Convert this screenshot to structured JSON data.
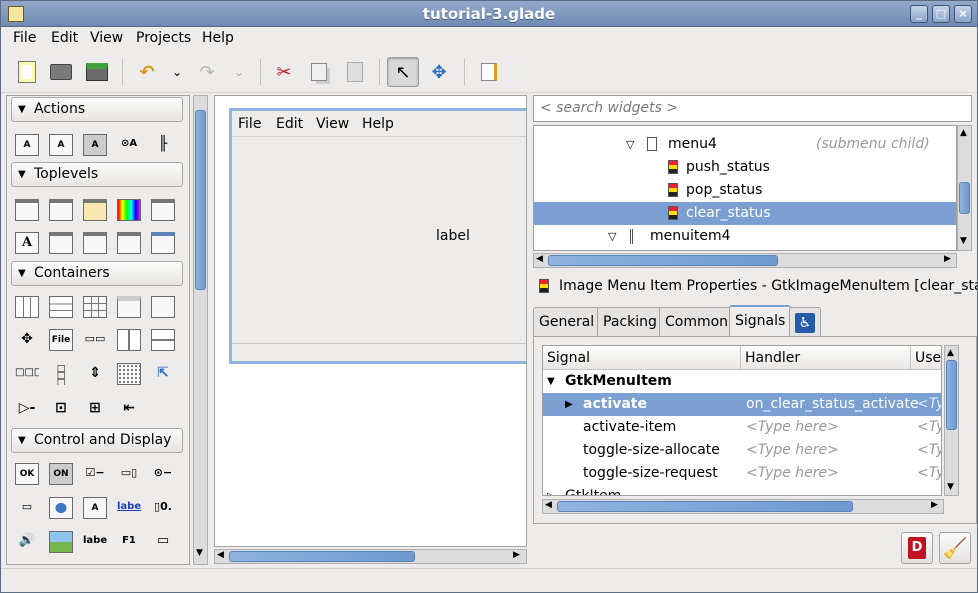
{
  "window": {
    "title": "tutorial-3.glade"
  },
  "menubar": {
    "file": "File",
    "edit": "Edit",
    "view": "View",
    "projects": "Projects",
    "help": "Help"
  },
  "palette": {
    "groups": [
      "Actions",
      "Toplevels",
      "Containers",
      "Control and Display"
    ],
    "widget_text": {
      "file": "File",
      "label_link": "label",
      "label_plain": "label",
      "f1": "F1",
      "ok": "OK",
      "on": "ON"
    }
  },
  "design": {
    "menu": [
      "File",
      "Edit",
      "View",
      "Help"
    ],
    "label": "label"
  },
  "search": {
    "placeholder": "< search widgets >"
  },
  "tree": {
    "rows": [
      {
        "name": "menu4",
        "note": "(submenu child)"
      },
      {
        "name": "push_status"
      },
      {
        "name": "pop_status"
      },
      {
        "name": "clear_status"
      },
      {
        "name": "menuitem4"
      }
    ]
  },
  "properties": {
    "header": "Image Menu Item Properties - GtkImageMenuItem [clear_sta..."
  },
  "tabs": [
    "General",
    "Packing",
    "Common",
    "Signals"
  ],
  "signals": {
    "columns": [
      "Signal",
      "Handler",
      "User"
    ],
    "group": "GtkMenuItem",
    "rows": [
      {
        "signal": "activate",
        "handler": "on_clear_status_activate",
        "user": "<Ty"
      },
      {
        "signal": "activate-item",
        "handler": "<Type here>",
        "user": "<Ty"
      },
      {
        "signal": "toggle-size-allocate",
        "handler": "<Type here>",
        "user": "<Ty"
      },
      {
        "signal": "toggle-size-request",
        "handler": "<Type here>",
        "user": "<Ty"
      }
    ],
    "next_group": "GtkItem"
  },
  "colors": {
    "selection": "#7c9fd1",
    "titlebar": "#7f98bd"
  }
}
